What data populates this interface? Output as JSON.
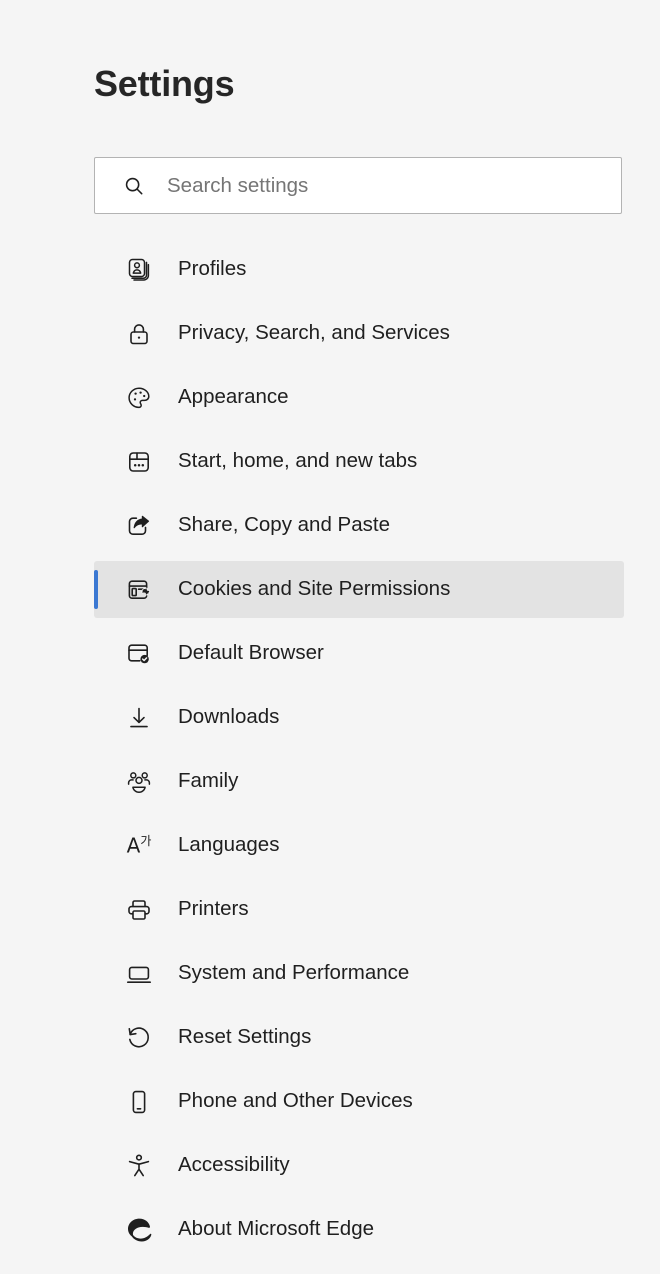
{
  "page": {
    "title": "Settings",
    "background_color": "#f5f5f5"
  },
  "search": {
    "placeholder": "Search settings",
    "value": "",
    "icon": "search-icon"
  },
  "theme": {
    "accent_color": "#3b78d2",
    "selected_row_color": "#e3e3e3",
    "text_color": "#1f1f1f",
    "placeholder_color": "#757575"
  },
  "nav": {
    "selected_index": 5,
    "items": [
      {
        "label": "Profiles",
        "icon": "profiles-icon",
        "selected": false
      },
      {
        "label": "Privacy, Search, and Services",
        "icon": "lock-icon",
        "selected": false
      },
      {
        "label": "Appearance",
        "icon": "palette-icon",
        "selected": false
      },
      {
        "label": "Start, home, and new tabs",
        "icon": "browser-tabs-icon",
        "selected": false
      },
      {
        "label": "Share, Copy and Paste",
        "icon": "share-icon",
        "selected": false
      },
      {
        "label": "Cookies and Site Permissions",
        "icon": "cookies-permissions-icon",
        "selected": true
      },
      {
        "label": "Default Browser",
        "icon": "default-browser-icon",
        "selected": false
      },
      {
        "label": "Downloads",
        "icon": "download-icon",
        "selected": false
      },
      {
        "label": "Family",
        "icon": "family-icon",
        "selected": false
      },
      {
        "label": "Languages",
        "icon": "languages-icon",
        "selected": false
      },
      {
        "label": "Printers",
        "icon": "printer-icon",
        "selected": false
      },
      {
        "label": "System and Performance",
        "icon": "monitor-icon",
        "selected": false
      },
      {
        "label": "Reset Settings",
        "icon": "reset-icon",
        "selected": false
      },
      {
        "label": "Phone and Other Devices",
        "icon": "phone-icon",
        "selected": false
      },
      {
        "label": "Accessibility",
        "icon": "accessibility-icon",
        "selected": false
      },
      {
        "label": "About Microsoft Edge",
        "icon": "edge-logo-icon",
        "selected": false
      }
    ]
  }
}
